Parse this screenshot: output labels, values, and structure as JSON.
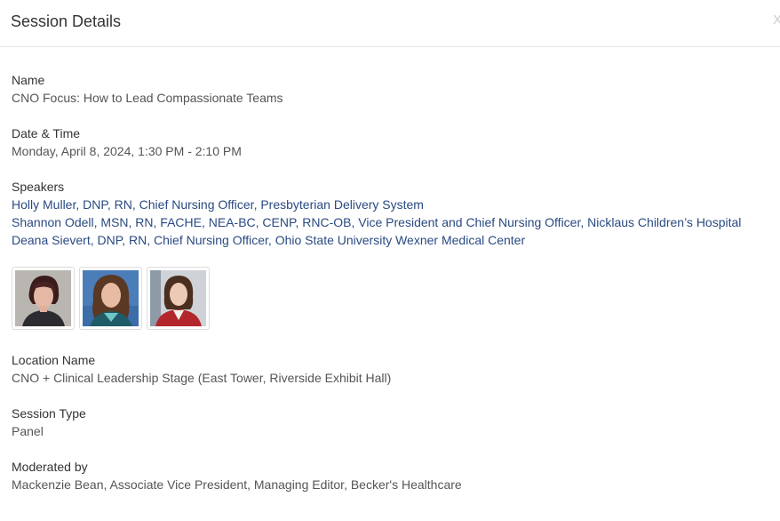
{
  "dialog": {
    "title": "Session Details",
    "close_label": "X"
  },
  "session": {
    "name_label": "Name",
    "name": "CNO Focus: How to Lead Compassionate Teams",
    "datetime_label": "Date & Time",
    "datetime": "Monday, April 8, 2024, 1:30 PM - 2:10 PM",
    "speakers_label": "Speakers",
    "speakers": [
      "Holly Muller, DNP, RN, Chief Nursing Officer, Presbyterian Delivery System",
      "Shannon Odell, MSN, RN, FACHE, NEA-BC, CENP, RNC-OB, Vice President and Chief Nursing Officer, Nicklaus Children’s Hospital",
      "Deana Sievert, DNP, RN, Chief Nursing Officer, Ohio State University Wexner Medical Center"
    ],
    "location_label": "Location Name",
    "location": "CNO + Clinical Leadership Stage (East Tower, Riverside Exhibit Hall)",
    "type_label": "Session Type",
    "type": "Panel",
    "moderator_label": "Moderated by",
    "moderator": "Mackenzie Bean, Associate Vice President, Managing Editor, Becker's Healthcare"
  },
  "colors": {
    "link": "#2a4a82",
    "label": "#333333",
    "text": "#555555"
  }
}
